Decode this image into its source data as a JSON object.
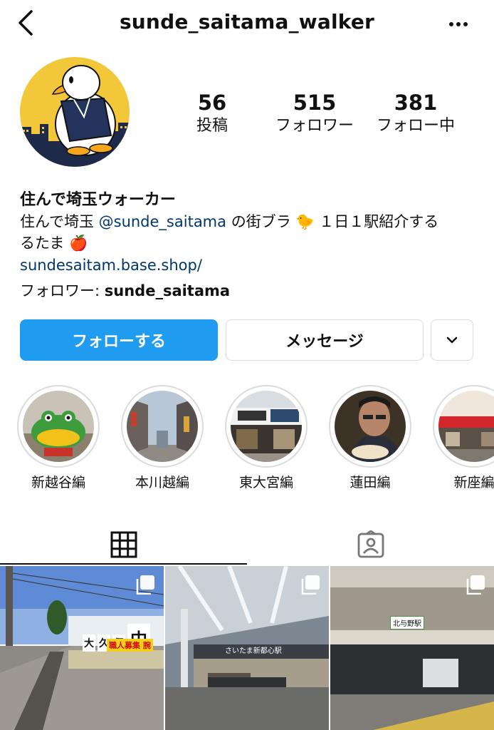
{
  "header": {
    "username": "sunde_saitama_walker"
  },
  "profile": {
    "stats": [
      {
        "value": "56",
        "label": "投稿"
      },
      {
        "value": "515",
        "label": "フォロワー"
      },
      {
        "value": "381",
        "label": "フォロー中"
      }
    ],
    "display_name": "住んで埼玉ウォーカー",
    "bio_prefix": "住んで埼玉 ",
    "bio_mention": "@sunde_saitama",
    "bio_rest": " の街ブラ 🐤 １日１駅紹介する",
    "bio_line2": "るたま 🍎",
    "link": "sundesaitam.base.shop/",
    "followed_by_label": "フォロワー: ",
    "followed_by_user": "sunde_saitama"
  },
  "actions": {
    "follow": "フォローする",
    "message": "メッセージ"
  },
  "highlights": [
    {
      "label": "新越谷編"
    },
    {
      "label": "本川越編"
    },
    {
      "label": "東大宮編"
    },
    {
      "label": "蓮田編"
    },
    {
      "label": "新座編"
    }
  ],
  "tabs": [
    {
      "name": "grid-icon"
    },
    {
      "name": "tagged-icon"
    }
  ],
  "posts": [
    {
      "sign_chars": [
        "大",
        "久",
        "保",
        "中"
      ],
      "banner": "職人募集 腕"
    },
    {
      "station_sign": "さいたま新都心駅"
    },
    {
      "jr_label": "北与野駅"
    }
  ],
  "colors": {
    "accent": "#1f9bf0",
    "link": "#00376b",
    "avatar_bg": "#f2c73a"
  }
}
